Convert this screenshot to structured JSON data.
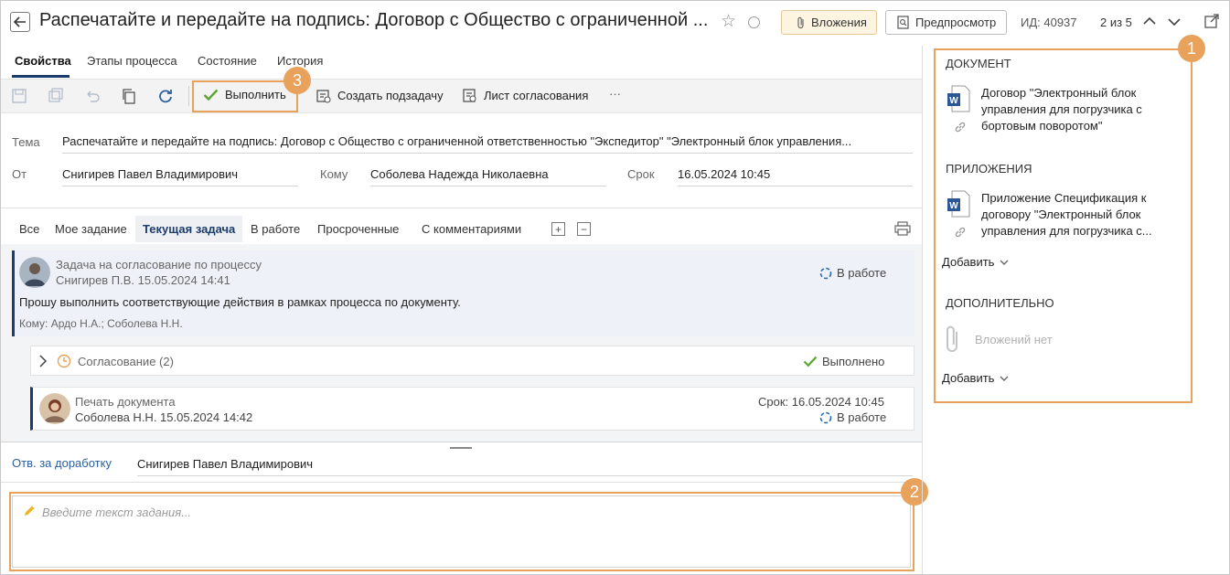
{
  "header": {
    "title": "Распечатайте и передайте на подпись: Договор с Общество с ограниченной ...",
    "attachments_label": "Вложения",
    "preview_label": "Предпросмотр",
    "id_text": "ИД: 40937",
    "pager_text": "2 из 5"
  },
  "tabs": [
    "Свойства",
    "Этапы процесса",
    "Состояние",
    "История"
  ],
  "toolbar": {
    "complete_label": "Выполнить",
    "subtask_label": "Создать подзадачу",
    "approval_sheet_label": "Лист согласования",
    "more_label": "···"
  },
  "form": {
    "subject_label": "Тема",
    "subject_value": "Распечатайте и передайте на подпись: Договор с Общество с ограниченной ответственностью \"Экспедитор\" \"Электронный блок управления...",
    "from_label": "От",
    "from_value": "Снигирев Павел Владимирович",
    "to_label": "Кому",
    "to_value": "Соболева Надежда Николаевна",
    "due_label": "Срок",
    "due_value": "16.05.2024 10:45"
  },
  "filters": [
    "Все",
    "Мое задание",
    "Текущая задача",
    "В работе",
    "Просроченные",
    "С комментариями"
  ],
  "feed": {
    "item1": {
      "title": "Задача на согласование по процессу",
      "author_date": "Снигирев П.В.  15.05.2024 14:41",
      "status": "В работе",
      "message": "Прошу выполнить соответствующие действия в рамках процесса по документу.",
      "recipients": "Кому: Ардо Н.А.; Соболева Н.Н."
    },
    "item2": {
      "title": "Согласование (2)",
      "status": "Выполнено"
    },
    "item3": {
      "title": "Печать документа",
      "author_date": "Соболева Н.Н.  15.05.2024 14:42",
      "due": "Срок: 16.05.2024 10:45",
      "status": "В работе"
    }
  },
  "rework": {
    "label": "Отв. за доработку",
    "value": "Снигирев Павел Владимирович"
  },
  "task_input": {
    "placeholder": "Введите текст задания..."
  },
  "right_panel": {
    "document_heading": "ДОКУМЕНТ",
    "document_name": "Договор \"Электронный блок управления для погрузчика с бортовым поворотом\"",
    "appendix_heading": "ПРИЛОЖЕНИЯ",
    "appendix_name": "Приложение Спецификация к договору \"Электронный блок управления для погрузчика с...",
    "add_label": "Добавить",
    "extra_heading": "ДОПОЛНИТЕЛЬНО",
    "no_attachments": "Вложений нет",
    "add_label_2": "Добавить"
  },
  "callouts": [
    "1",
    "2",
    "3"
  ],
  "colors": {
    "accent": "#1d3c6e",
    "callout": "#e8a25c",
    "success": "#5aa832",
    "word_blue": "#2b5797"
  }
}
